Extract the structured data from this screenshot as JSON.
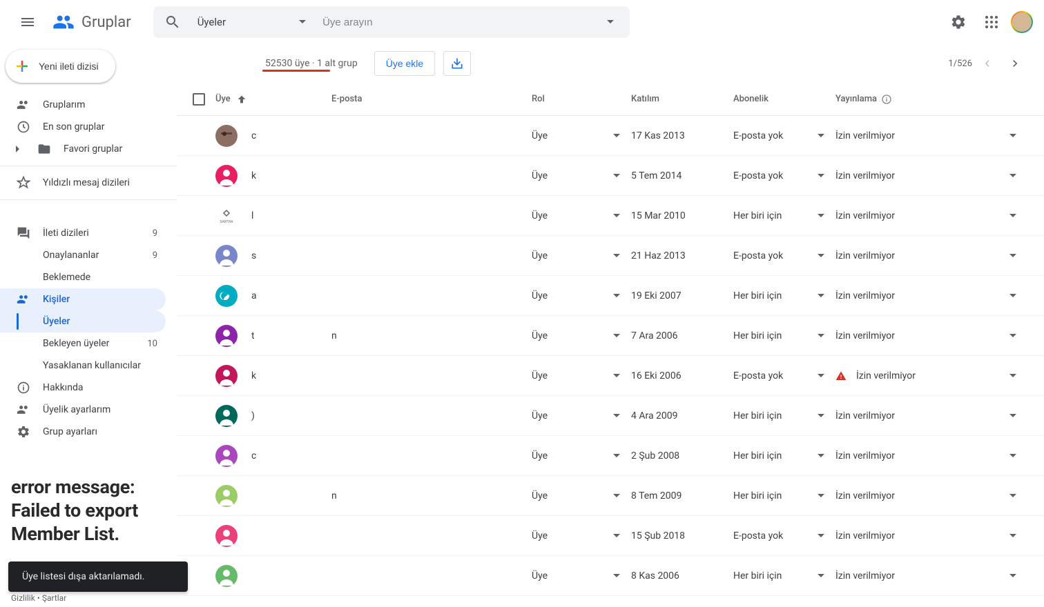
{
  "header": {
    "logo_text": "Gruplar",
    "search_filter": "Üyeler",
    "search_placeholder": "Üye arayın"
  },
  "sidebar": {
    "new_thread": "Yeni ileti dizisi",
    "items": {
      "my_groups": "Gruplarım",
      "recent_groups": "En son gruplar",
      "favorite_groups": "Favori gruplar",
      "starred": "Yıldızlı mesaj dizileri",
      "threads": "İleti dizileri",
      "threads_count": "9",
      "approved": "Onaylananlar",
      "approved_count": "9",
      "pending": "Beklemede",
      "people": "Kişiler",
      "members": "Üyeler",
      "pending_members": "Bekleyen üyeler",
      "pending_members_count": "10",
      "banned": "Yasaklanan kullanıcılar",
      "about": "Hakkında",
      "membership": "Üyelik ayarlarım",
      "group_settings": "Grup ayarları"
    }
  },
  "overlay": {
    "line1": "error message:",
    "line2": "Failed to export Member List.",
    "toast": "Üye listesi dışa aktarılamadı.",
    "footer_privacy": "Gizlilik",
    "footer_terms": "Şartlar"
  },
  "content": {
    "member_count": "52530 üye · 1 alt grup",
    "add_member": "Üye ekle",
    "pagination": "1/526",
    "columns": {
      "member": "Üye",
      "email": "E-posta",
      "role": "Rol",
      "join": "Katılım",
      "subscription": "Abonelik",
      "posting": "Yayınlama"
    },
    "rows": [
      {
        "avatar_color": "#8d6e63",
        "avatar_type": "photo",
        "name": "c",
        "email": " ",
        "role": "Üye",
        "join": "17 Kas 2013",
        "subscription": "E-posta yok",
        "posting": "İzin verilmiyor",
        "warn": false
      },
      {
        "avatar_color": "#e91e63",
        "avatar_type": "person",
        "name": "k",
        "email": " ",
        "role": "Üye",
        "join": "5 Tem 2014",
        "subscription": "E-posta yok",
        "posting": "İzin verilmiyor",
        "warn": false
      },
      {
        "avatar_color": "#ffffff",
        "avatar_type": "logo",
        "name": "l",
        "email": " ",
        "role": "Üye",
        "join": "15 Mar 2010",
        "subscription": "Her biri için",
        "posting": "İzin verilmiyor",
        "warn": false
      },
      {
        "avatar_color": "#7986cb",
        "avatar_type": "person",
        "name": "s",
        "email": " ",
        "role": "Üye",
        "join": "21 Haz 2013",
        "subscription": "E-posta yok",
        "posting": "İzin verilmiyor",
        "warn": false
      },
      {
        "avatar_color": "#00acc1",
        "avatar_type": "flag",
        "name": "a",
        "email": " ",
        "role": "Üye",
        "join": "19 Eki 2007",
        "subscription": "Her biri için",
        "posting": "İzin verilmiyor",
        "warn": false
      },
      {
        "avatar_color": "#8e24aa",
        "avatar_type": "person",
        "name": "t",
        "email": "n",
        "role": "Üye",
        "join": "7 Ara 2006",
        "subscription": "Her biri için",
        "posting": "İzin verilmiyor",
        "warn": false
      },
      {
        "avatar_color": "#c2185b",
        "avatar_type": "person",
        "name": "k",
        "email": " ",
        "role": "Üye",
        "join": "16 Eki 2006",
        "subscription": "E-posta yok",
        "posting": "İzin verilmiyor",
        "warn": true
      },
      {
        "avatar_color": "#00695c",
        "avatar_type": "person",
        "name": ")",
        "email": " ",
        "role": "Üye",
        "join": "4 Ara 2009",
        "subscription": "Her biri için",
        "posting": "İzin verilmiyor",
        "warn": false
      },
      {
        "avatar_color": "#ab47bc",
        "avatar_type": "person",
        "name": "c",
        "email": " ",
        "role": "Üye",
        "join": "2 Şub 2008",
        "subscription": "Her biri için",
        "posting": "İzin verilmiyor",
        "warn": false
      },
      {
        "avatar_color": "#9ccc65",
        "avatar_type": "person",
        "name": " ",
        "email": "n",
        "role": "Üye",
        "join": "8 Tem 2009",
        "subscription": "Her biri için",
        "posting": "İzin verilmiyor",
        "warn": false
      },
      {
        "avatar_color": "#ec407a",
        "avatar_type": "person",
        "name": " ",
        "email": " ",
        "role": "Üye",
        "join": "15 Şub 2018",
        "subscription": "E-posta yok",
        "posting": "İzin verilmiyor",
        "warn": false
      },
      {
        "avatar_color": "#66bb6a",
        "avatar_type": "person",
        "name": " ",
        "email": " ",
        "role": "Üye",
        "join": "8 Kas 2006",
        "subscription": "Her biri için",
        "posting": "İzin verilmiyor",
        "warn": false
      }
    ]
  }
}
